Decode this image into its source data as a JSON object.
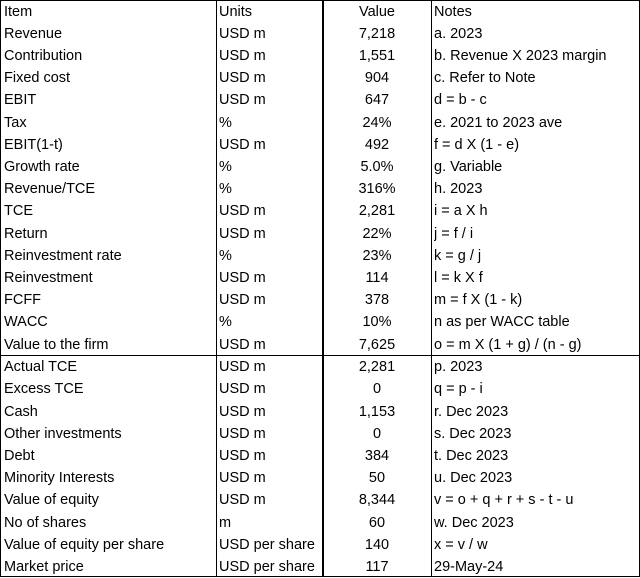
{
  "header": {
    "item": "Item",
    "units": "Units",
    "value": "Value",
    "notes": "Notes"
  },
  "rows": [
    {
      "item": "Revenue",
      "units": "USD m",
      "value": "7,218",
      "notes": "a. 2023"
    },
    {
      "item": "Contribution",
      "units": "USD m",
      "value": "1,551",
      "notes": "b. Revenue X 2023 margin"
    },
    {
      "item": "Fixed cost",
      "units": "USD m",
      "value": "904",
      "notes": "c. Refer to Note"
    },
    {
      "item": "EBIT",
      "units": "USD m",
      "value": "647",
      "notes": "d = b - c"
    },
    {
      "item": "Tax",
      "units": "%",
      "value": "24%",
      "notes": "e. 2021 to 2023 ave"
    },
    {
      "item": "EBIT(1-t)",
      "units": "USD m",
      "value": "492",
      "notes": "f = d X (1 - e)"
    },
    {
      "item": "Growth rate",
      "units": "%",
      "value": "5.0%",
      "notes": "g. Variable"
    },
    {
      "item": "Revenue/TCE",
      "units": "%",
      "value": "316%",
      "notes": "h. 2023"
    },
    {
      "item": "TCE",
      "units": "USD m",
      "value": "2,281",
      "notes": "i = a X h"
    },
    {
      "item": "Return",
      "units": "USD m",
      "value": "22%",
      "notes": "j = f / i"
    },
    {
      "item": "Reinvestment rate",
      "units": "%",
      "value": "23%",
      "notes": "k = g / j"
    },
    {
      "item": "Reinvestment",
      "units": "USD m",
      "value": "114",
      "notes": "l = k X f"
    },
    {
      "item": "FCFF",
      "units": "USD m",
      "value": "378",
      "notes": "m = f X (1 - k)"
    },
    {
      "item": "WACC",
      "units": "%",
      "value": "10%",
      "notes": "n as per WACC table"
    },
    {
      "item": "Value to the firm",
      "units": "USD m",
      "value": "7,625",
      "notes": "o = m X (1 + g) / (n - g)"
    },
    {
      "item": "Actual TCE",
      "units": "USD m",
      "value": "2,281",
      "notes": "p. 2023"
    },
    {
      "item": "Excess TCE",
      "units": "USD m",
      "value": "0",
      "notes": "q = p - i"
    },
    {
      "item": "Cash",
      "units": "USD m",
      "value": "1,153",
      "notes": "r. Dec 2023"
    },
    {
      "item": "Other investments",
      "units": "USD m",
      "value": "0",
      "notes": "s. Dec 2023"
    },
    {
      "item": "Debt",
      "units": "USD m",
      "value": "384",
      "notes": "t. Dec 2023"
    },
    {
      "item": "Minority Interests",
      "units": "USD m",
      "value": "50",
      "notes": "u. Dec 2023"
    },
    {
      "item": "Value of equity",
      "units": "USD m",
      "value": "8,344",
      "notes": "v = o + q + r + s - t - u"
    },
    {
      "item": "No of shares",
      "units": "m",
      "value": "60",
      "notes": "w. Dec 2023"
    },
    {
      "item": "Value of equity per share",
      "units": "USD per share",
      "value": "140",
      "notes": "x = v / w"
    },
    {
      "item": "Market price",
      "units": "USD per share",
      "value": "117",
      "notes": "29-May-24"
    }
  ]
}
